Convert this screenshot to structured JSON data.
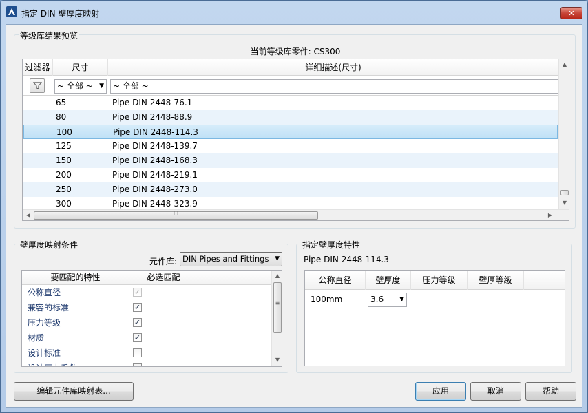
{
  "window": {
    "title": "指定 DIN 壁厚度映射",
    "close_glyph": "✕"
  },
  "preview": {
    "group_label": "等级库结果预览",
    "current_part_label": "当前等级库零件: CS300",
    "columns": {
      "filter": "过滤器",
      "size": "尺寸",
      "description": "详细描述(尺寸)"
    },
    "filter_size_value": "~ 全部 ~",
    "filter_desc_value": "~ 全部 ~",
    "rows": [
      {
        "size": "65",
        "desc": "Pipe DIN 2448-76.1"
      },
      {
        "size": "80",
        "desc": "Pipe DIN 2448-88.9"
      },
      {
        "size": "100",
        "desc": "Pipe DIN 2448-114.3"
      },
      {
        "size": "125",
        "desc": "Pipe DIN 2448-139.7"
      },
      {
        "size": "150",
        "desc": "Pipe DIN 2448-168.3"
      },
      {
        "size": "200",
        "desc": "Pipe DIN 2448-219.1"
      },
      {
        "size": "250",
        "desc": "Pipe DIN 2448-273.0"
      },
      {
        "size": "300",
        "desc": "Pipe DIN 2448-323.9"
      }
    ],
    "selected_row": 2,
    "hscroll_grip": "III"
  },
  "mapping": {
    "group_label": "壁厚度映射条件",
    "library_label": "元件库:",
    "library_value": "DIN Pipes and Fittings",
    "columns": {
      "property": "要匹配的特性",
      "required": "必选匹配"
    },
    "rows": [
      {
        "name": "公称直径",
        "checked": true,
        "disabled": true
      },
      {
        "name": "兼容的标准",
        "checked": true,
        "disabled": false
      },
      {
        "name": "压力等级",
        "checked": true,
        "disabled": false
      },
      {
        "name": "材质",
        "checked": true,
        "disabled": false
      },
      {
        "name": "设计标准",
        "checked": false,
        "disabled": false
      },
      {
        "name": "设计压力系数",
        "checked": true,
        "disabled": false
      }
    ]
  },
  "wall": {
    "group_label": "指定壁厚度特性",
    "part_name": "Pipe DIN 2448-114.3",
    "columns": {
      "nominal": "公称直径",
      "thickness": "壁厚度",
      "pressure": "压力等级",
      "wall_class": "壁厚等级"
    },
    "row": {
      "nominal": "100mm",
      "thickness": "3.6"
    }
  },
  "buttons": {
    "edit_mapping": "编辑元件库映射表...",
    "apply": "应用",
    "cancel": "取消",
    "help": "帮助"
  }
}
